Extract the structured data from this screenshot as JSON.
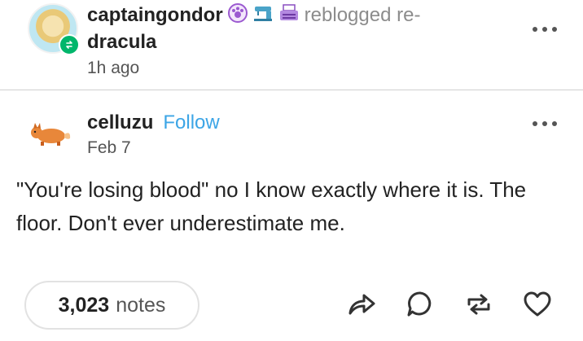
{
  "reblog_header": {
    "username": "captaingondor",
    "reblogged_text": "reblogged re-",
    "source_username": "dracula",
    "time": "1h ago"
  },
  "original_post": {
    "username": "celluzu",
    "follow_label": "Follow",
    "date": "Feb 7",
    "text": "\"You're losing blood\" no I know exactly where it is. The floor. Don't ever underestimate me."
  },
  "footer": {
    "notes_count": "3,023",
    "notes_label": "notes"
  },
  "icons": {
    "badges": [
      "paw-badge-icon",
      "sewing-machine-badge-icon",
      "typewriter-badge-icon"
    ],
    "actions": [
      "share-icon",
      "reply-icon",
      "reblog-icon",
      "like-icon"
    ]
  },
  "colors": {
    "accent_blue": "#3ca5e6",
    "reblog_green": "#00b66b",
    "badge_purple": "#9b59d0"
  }
}
